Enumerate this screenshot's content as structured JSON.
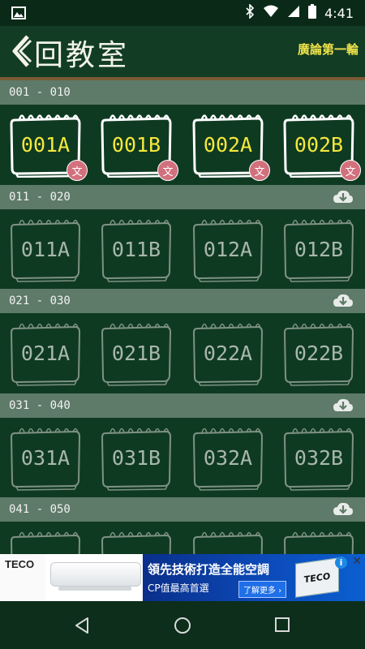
{
  "status_bar": {
    "time": "4:41"
  },
  "header": {
    "back_title": "回教室",
    "right_text": "廣論第一輪"
  },
  "sections": [
    {
      "range": "001 - 010",
      "downloaded": true,
      "tiles": [
        "001A",
        "001B",
        "002A",
        "002B"
      ]
    },
    {
      "range": "011 - 020",
      "downloaded": false,
      "tiles": [
        "011A",
        "011B",
        "012A",
        "012B"
      ]
    },
    {
      "range": "021 - 030",
      "downloaded": false,
      "tiles": [
        "021A",
        "021B",
        "022A",
        "022B"
      ]
    },
    {
      "range": "031 - 040",
      "downloaded": false,
      "tiles": [
        "031A",
        "031B",
        "032A",
        "032B"
      ]
    },
    {
      "range": "041 - 050",
      "downloaded": false,
      "tiles": [
        "",
        "",
        "",
        ""
      ]
    }
  ],
  "badge_text": "文",
  "ad": {
    "brand": "TECO",
    "title": "領先技術打造全能空調",
    "subtitle": "CP值最高首選",
    "cta": "了解更多 ›",
    "chip_text": "TECO",
    "info": "i",
    "close": "✕"
  },
  "colors": {
    "background": "#0f3a22",
    "section_bar": "#5e7a68",
    "active_label": "#f5e83c",
    "inactive_label": "#a8b7ab",
    "badge": "#d2717d"
  },
  "icons": {
    "back": "chevron-left-icon",
    "download": "cloud-download-icon",
    "nav": [
      "back-triangle-icon",
      "home-circle-icon",
      "recents-square-icon"
    ]
  }
}
